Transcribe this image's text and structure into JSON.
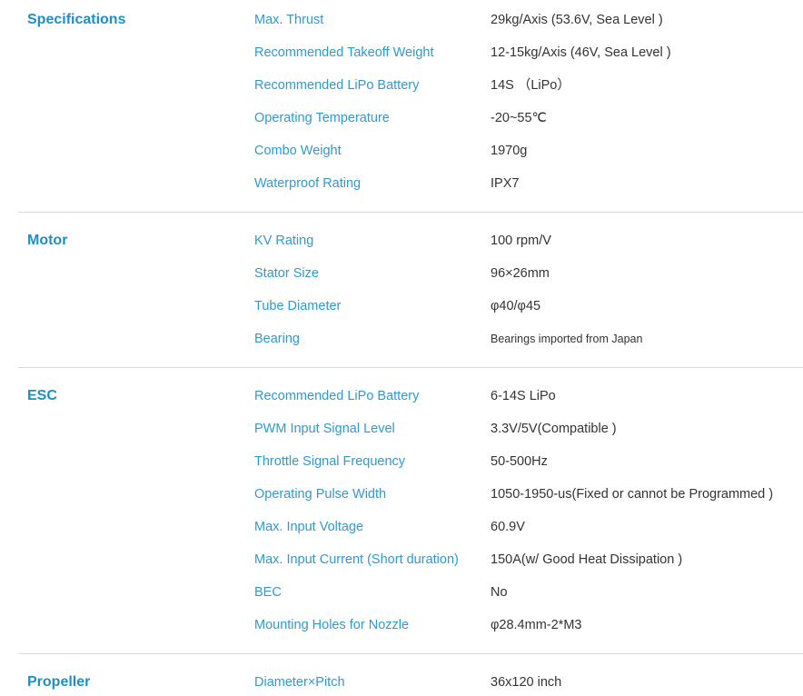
{
  "sections": [
    {
      "title": "Specifications",
      "rows": [
        {
          "label": "Max. Thrust",
          "value": "29kg/Axis (53.6V, Sea Level )"
        },
        {
          "label": "Recommended Takeoff Weight",
          "value": "12-15kg/Axis (46V, Sea Level )"
        },
        {
          "label": "Recommended LiPo Battery",
          "value": "14S （LiPo）"
        },
        {
          "label": "Operating Temperature",
          "value": "-20~55℃"
        },
        {
          "label": "Combo Weight",
          "value": "1970g"
        },
        {
          "label": "Waterproof Rating",
          "value": "IPX7"
        }
      ]
    },
    {
      "title": "Motor",
      "rows": [
        {
          "label": "KV Rating",
          "value": "100 rpm/V"
        },
        {
          "label": "Stator Size",
          "value": "96×26mm"
        },
        {
          "label": "Tube Diameter",
          "value": "φ40/φ45"
        },
        {
          "label": "Bearing",
          "value": "Bearings imported from Japan"
        }
      ]
    },
    {
      "title": "ESC",
      "rows": [
        {
          "label": "Recommended LiPo Battery",
          "value": "6-14S LiPo"
        },
        {
          "label": "PWM Input Signal Level",
          "value": "3.3V/5V(Compatible )"
        },
        {
          "label": "Throttle Signal Frequency",
          "value": "50-500Hz"
        },
        {
          "label": "Operating Pulse Width",
          "value": "1050-1950-us(Fixed or cannot be Programmed )"
        },
        {
          "label": "Max. Input Voltage",
          "value": "60.9V"
        },
        {
          "label": "Max. Input Current (Short duration)",
          "value": "150A(w/ Good Heat Dissipation )"
        },
        {
          "label": "BEC",
          "value": "No"
        },
        {
          "label": "Mounting Holes for Nozzle",
          "value": "φ28.4mm-2*M3"
        }
      ]
    },
    {
      "title": "Propeller",
      "rows": [
        {
          "label": "Diameter×Pitch",
          "value": "36x120 inch"
        }
      ]
    }
  ]
}
